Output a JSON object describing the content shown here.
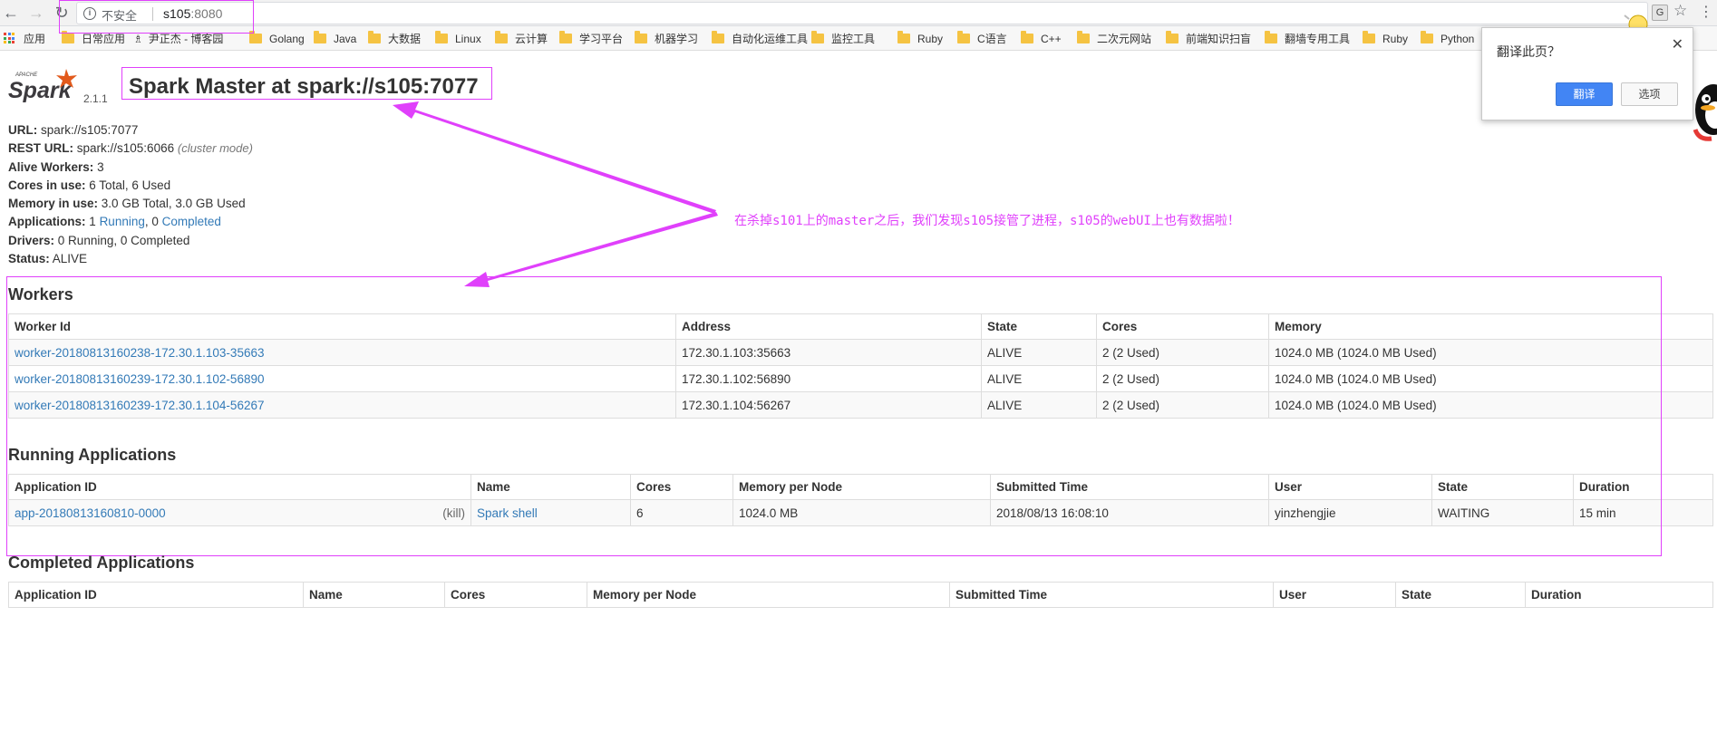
{
  "browser": {
    "insecure_label": "不安全",
    "url_host": "s105",
    "url_port": ":8080",
    "icons": [
      "back-icon",
      "forward-icon",
      "reload-icon",
      "info-icon",
      "translate-icon",
      "star-icon",
      "menu-icon"
    ]
  },
  "bookmarks": [
    {
      "label": "应用",
      "kind": "apps"
    },
    {
      "label": "日常应用",
      "kind": "folder"
    },
    {
      "label": "尹正杰 - 博客园",
      "kind": "site"
    },
    {
      "label": "Golang",
      "kind": "folder"
    },
    {
      "label": "Java",
      "kind": "folder"
    },
    {
      "label": "大数据",
      "kind": "folder"
    },
    {
      "label": "Linux",
      "kind": "folder"
    },
    {
      "label": "云计算",
      "kind": "folder"
    },
    {
      "label": "学习平台",
      "kind": "folder"
    },
    {
      "label": "机器学习",
      "kind": "folder"
    },
    {
      "label": "自动化运维工具",
      "kind": "folder"
    },
    {
      "label": "监控工具",
      "kind": "folder"
    },
    {
      "label": "Ruby",
      "kind": "folder"
    },
    {
      "label": "C语言",
      "kind": "folder"
    },
    {
      "label": "C++",
      "kind": "folder"
    },
    {
      "label": "二次元网站",
      "kind": "folder"
    },
    {
      "label": "前端知识扫盲",
      "kind": "folder"
    },
    {
      "label": "翻墙专用工具",
      "kind": "folder"
    },
    {
      "label": "Ruby",
      "kind": "folder"
    },
    {
      "label": "Python",
      "kind": "folder"
    }
  ],
  "header": {
    "logo_small": "APACHE",
    "logo_text": "Spark",
    "version": "2.1.1",
    "title": "Spark Master at spark://s105:7077"
  },
  "summary": {
    "url_label": "URL:",
    "url_value": "spark://s105:7077",
    "rest_label": "REST URL:",
    "rest_value": "spark://s105:6066",
    "rest_mode": "(cluster mode)",
    "alive_label": "Alive Workers:",
    "alive_value": "3",
    "cores_label": "Cores in use:",
    "cores_value": "6 Total, 6 Used",
    "memory_label": "Memory in use:",
    "memory_value": "3.0 GB Total, 3.0 GB Used",
    "apps_label": "Applications:",
    "apps_running_count": "1",
    "apps_running_link": "Running",
    "apps_sep": ", 0",
    "apps_completed_link": "Completed",
    "drivers_label": "Drivers:",
    "drivers_value": "0 Running, 0 Completed",
    "status_label": "Status:",
    "status_value": "ALIVE"
  },
  "annotation": "在杀掉s101上的master之后，我们发现s105接管了进程，s105的webUI上也有数据啦！",
  "workers": {
    "heading": "Workers",
    "columns": [
      "Worker Id",
      "Address",
      "State",
      "Cores",
      "Memory"
    ],
    "rows": [
      [
        "worker-20180813160238-172.30.1.103-35663",
        "172.30.1.103:35663",
        "ALIVE",
        "2 (2 Used)",
        "1024.0 MB (1024.0 MB Used)"
      ],
      [
        "worker-20180813160239-172.30.1.102-56890",
        "172.30.1.102:56890",
        "ALIVE",
        "2 (2 Used)",
        "1024.0 MB (1024.0 MB Used)"
      ],
      [
        "worker-20180813160239-172.30.1.104-56267",
        "172.30.1.104:56267",
        "ALIVE",
        "2 (2 Used)",
        "1024.0 MB (1024.0 MB Used)"
      ]
    ]
  },
  "running": {
    "heading": "Running Applications",
    "columns": [
      "Application ID",
      "Name",
      "Cores",
      "Memory per Node",
      "Submitted Time",
      "User",
      "State",
      "Duration"
    ],
    "rows": [
      {
        "id": "app-20180813160810-0000",
        "kill": "(kill)",
        "name": "Spark shell",
        "cores": "6",
        "memory": "1024.0 MB",
        "submitted": "2018/08/13 16:08:10",
        "user": "yinzhengjie",
        "state": "WAITING",
        "duration": "15 min"
      }
    ]
  },
  "completed": {
    "heading": "Completed Applications",
    "columns": [
      "Application ID",
      "Name",
      "Cores",
      "Memory per Node",
      "Submitted Time",
      "User",
      "State",
      "Duration"
    ]
  },
  "translate_popup": {
    "title": "翻译此页？",
    "close": "✕",
    "translate_button": "翻译",
    "options_button": "选项"
  },
  "colors": {
    "link": "#337ab7",
    "annotation": "#e040fb",
    "primary_button": "#4285f4"
  }
}
